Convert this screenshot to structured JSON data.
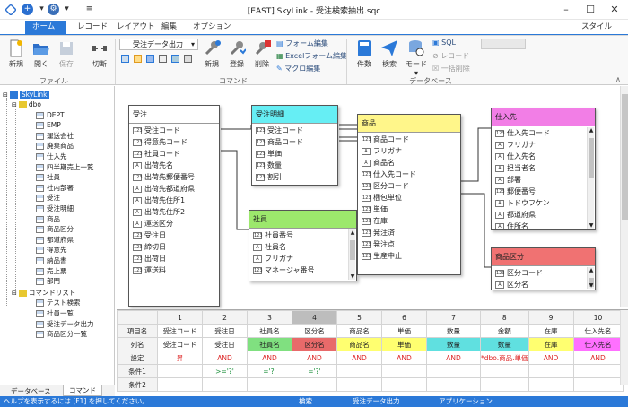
{
  "window": {
    "title": "[EAST] SkyLink - 受注検索抽出.sqc",
    "style_label": "スタイル"
  },
  "tabs": [
    "ホーム",
    "レコード",
    "レイアウト",
    "編集",
    "オプション"
  ],
  "ribbon": {
    "file_buttons": [
      "新規",
      "開く",
      "保存",
      "切断"
    ],
    "file_group": "ファイル",
    "form_dropdown": "受注データ出力",
    "cmd_buttons": [
      "新規",
      "登録",
      "削除"
    ],
    "form_links": [
      "フォーム編集",
      "Excelフォーム編集",
      "マクロ編集"
    ],
    "command_group": "コマンド",
    "db_buttons": [
      "件数",
      "検索",
      "モード"
    ],
    "db_links": [
      "SQL",
      "レコード",
      "一括削除"
    ],
    "database_group": "データベース"
  },
  "tree": {
    "root": "SkyLink",
    "schema": "dbo",
    "tables": [
      "DEPT",
      "EMP",
      "運送会社",
      "廃棄商品",
      "仕入先",
      "四半期売上一覧",
      "社員",
      "社内部署",
      "受注",
      "受注明細",
      "商品",
      "商品区分",
      "都道府県",
      "得意先",
      "納品書",
      "売上票",
      "部門"
    ],
    "command_list": "コマンドリスト",
    "commands": [
      "テスト検索",
      "社員一覧",
      "受注データ出力",
      "商品区分一覧"
    ]
  },
  "entities": {
    "juchu": {
      "title": "受注",
      "fields": [
        "受注コード",
        "得意先コード",
        "社員コード",
        "出荷先名",
        "出荷先郵便番号",
        "出荷先都道府県",
        "出荷先住所1",
        "出荷先住所2",
        "運送区分",
        "受注日",
        "締切日",
        "出荷日",
        "運送料"
      ]
    },
    "meisai": {
      "title": "受注明細",
      "fields": [
        "受注コード",
        "商品コード",
        "単価",
        "数量",
        "割引"
      ]
    },
    "shain": {
      "title": "社員",
      "fields": [
        "社員番号",
        "社員名",
        "フリガナ",
        "マネージャ番号"
      ]
    },
    "shohin": {
      "title": "商品",
      "fields": [
        "商品コード",
        "フリガナ",
        "商品名",
        "仕入先コード",
        "区分コード",
        "梱包単位",
        "単価",
        "在庫",
        "発注済",
        "発注点",
        "生産中止"
      ]
    },
    "shiiresaki": {
      "title": "仕入先",
      "fields": [
        "仕入先コード",
        "フリガナ",
        "仕入先名",
        "担当者名",
        "部署",
        "郵便番号",
        "トドウフケン",
        "都道府県",
        "住所名"
      ]
    },
    "kubun": {
      "title": "商品区分",
      "fields": [
        "区分コード",
        "区分名"
      ]
    }
  },
  "grid": {
    "row_headers": [
      "",
      "項目名",
      "列名",
      "設定",
      "条件1",
      "条件2"
    ],
    "columns": [
      "1",
      "2",
      "3",
      "4",
      "5",
      "6",
      "7",
      "8",
      "9",
      "10"
    ],
    "item_names": [
      "受注コード",
      "受注日",
      "社員名",
      "区分名",
      "商品名",
      "単価",
      "数量",
      "金額",
      "在庫",
      "仕入先名"
    ],
    "col_names": [
      "受注コード",
      "受注日",
      "社員名",
      "区分名",
      "商品名",
      "単価",
      "数量",
      "数量",
      "在庫",
      "仕入先名"
    ],
    "settings": [
      "昇",
      "AND",
      "AND",
      "AND",
      "AND",
      "AND",
      "AND",
      "*dbo.商品.単価",
      "AND",
      "AND"
    ],
    "cond1": [
      "",
      ">='?'",
      "='?'",
      "='?'",
      "",
      "",
      "",
      "",
      "",
      ""
    ],
    "col_colors": [
      "#ffffff",
      "#ffffff",
      "#80e080",
      "#e86a6a",
      "#ffff70",
      "#ffff70",
      "#60e0e0",
      "#60e0e0",
      "#ffff70",
      "#ff70ff"
    ]
  },
  "bottom_tabs": [
    "データベース",
    "コマンド"
  ],
  "status": [
    "ヘルプを表示するには [F1] を押してください。",
    "検索",
    "受注データ出力",
    "アプリケーション"
  ]
}
